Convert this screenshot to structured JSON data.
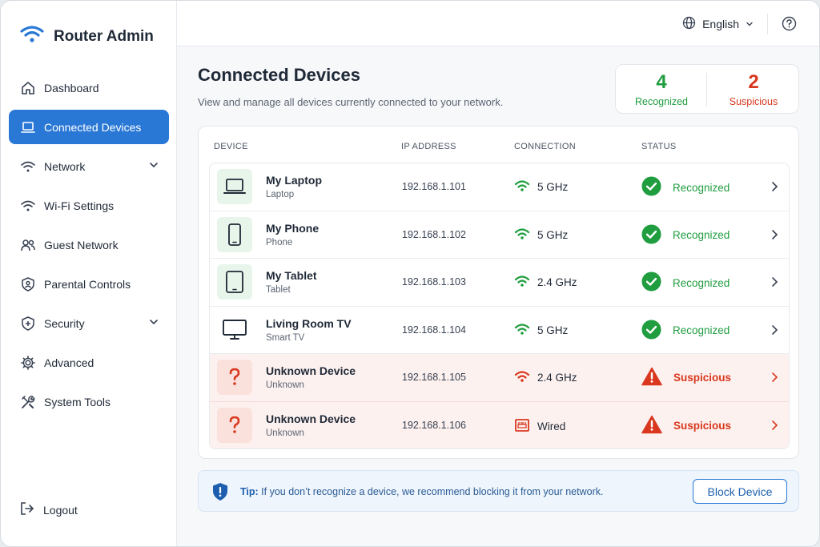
{
  "app": {
    "title": "Router Admin"
  },
  "topbar": {
    "language": "English"
  },
  "sidebar": {
    "items": [
      {
        "label": "Dashboard",
        "icon": "home-icon"
      },
      {
        "label": "Connected Devices",
        "icon": "laptop-icon",
        "active": true
      },
      {
        "label": "Network",
        "icon": "wifi-icon",
        "expandable": true
      },
      {
        "label": "Wi-Fi Settings",
        "icon": "wifi-icon"
      },
      {
        "label": "Guest Network",
        "icon": "users-icon"
      },
      {
        "label": "Parental Controls",
        "icon": "shield-user-icon"
      },
      {
        "label": "Security",
        "icon": "shield-plus-icon",
        "expandable": true
      },
      {
        "label": "Advanced",
        "icon": "gear-icon"
      },
      {
        "label": "System Tools",
        "icon": "tools-icon"
      }
    ],
    "logout": "Logout"
  },
  "main": {
    "title": "Connected Devices",
    "subtitle": "View and manage all devices currently connected to your network.",
    "stats": {
      "recognized": {
        "count": "4",
        "label": "Recognized"
      },
      "suspicious": {
        "count": "2",
        "label": "Suspicious"
      }
    },
    "table": {
      "headers": {
        "device": "DEVICE",
        "ip": "IP ADDRESS",
        "connection": "CONNECTION",
        "status": "STATUS"
      },
      "rows": [
        {
          "name": "My Laptop",
          "type": "Laptop",
          "ip": "192.168.1.101",
          "connection": "5 GHz",
          "status": "Recognized"
        },
        {
          "name": "My Phone",
          "type": "Phone",
          "ip": "192.168.1.102",
          "connection": "5 GHz",
          "status": "Recognized"
        },
        {
          "name": "My Tablet",
          "type": "Tablet",
          "ip": "192.168.1.103",
          "connection": "2.4 GHz",
          "status": "Recognized"
        },
        {
          "name": "Living Room TV",
          "type": "Smart TV",
          "ip": "192.168.1.104",
          "connection": "5 GHz",
          "status": "Recognized"
        },
        {
          "name": "Unknown Device",
          "type": "Unknown",
          "ip": "192.168.1.105",
          "connection": "2.4 GHz",
          "status": "Suspicious"
        },
        {
          "name": "Unknown Device",
          "type": "Unknown",
          "ip": "192.168.1.106",
          "connection": "Wired",
          "status": "Suspicious"
        }
      ]
    },
    "tip": {
      "label": "Tip:",
      "text": "If you don’t recognize a device, we recommend blocking it from your network.",
      "button": "Block Device"
    }
  },
  "colors": {
    "accent": "#2a78d6",
    "ok": "#1f9d3f",
    "danger": "#d9381e"
  }
}
